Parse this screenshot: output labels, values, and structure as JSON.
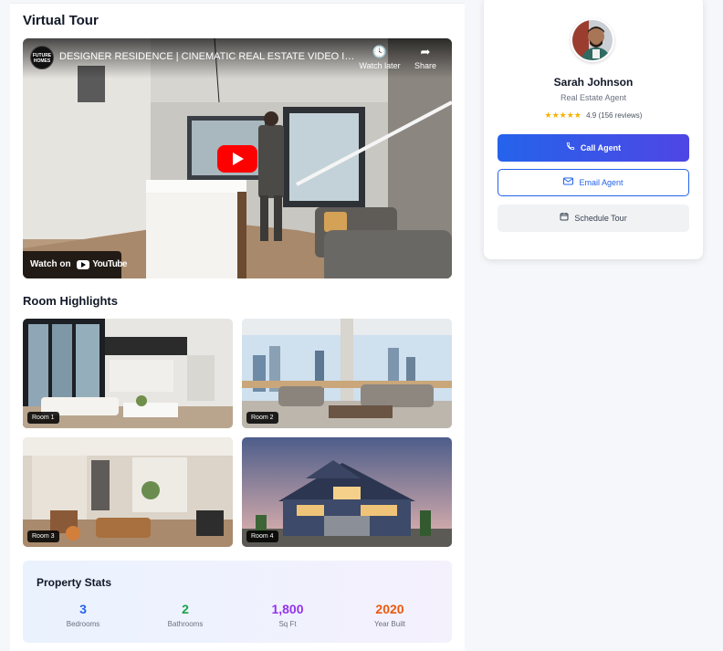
{
  "virtual_tour": {
    "title": "Virtual Tour",
    "video": {
      "channel_logo_text": "FUTURE HOMES",
      "title": "DESIGNER RESIDENCE | CINEMATIC REAL ESTATE VIDEO IN 4K...",
      "watch_later_label": "Watch later",
      "share_label": "Share",
      "watch_on_label": "Watch on",
      "youtube_label": "YouTube"
    }
  },
  "room_highlights": {
    "title": "Room Highlights",
    "rooms": [
      {
        "label": "Room 1"
      },
      {
        "label": "Room 2"
      },
      {
        "label": "Room 3"
      },
      {
        "label": "Room 4"
      }
    ]
  },
  "property_stats": {
    "title": "Property Stats",
    "items": [
      {
        "value": "3",
        "label": "Bedrooms",
        "color": "#2563eb"
      },
      {
        "value": "2",
        "label": "Bathrooms",
        "color": "#16a34a"
      },
      {
        "value": "1,800",
        "label": "Sq Ft",
        "color": "#9333ea"
      },
      {
        "value": "2020",
        "label": "Year Built",
        "color": "#ea580c"
      }
    ]
  },
  "agent": {
    "name": "Sarah Johnson",
    "role": "Real Estate Agent",
    "stars": "★★★★★",
    "rating_text": "4.9 (156 reviews)",
    "call_label": "Call Agent",
    "email_label": "Email Agent",
    "tour_label": "Schedule Tour"
  },
  "colors": {
    "accent": "#2563eb",
    "accent_secondary": "#4f46e5",
    "star": "#f5b301",
    "youtube_red": "#ff0000"
  },
  "icons": {
    "call": "phone-icon",
    "email": "mail-icon",
    "tour": "calendar-icon",
    "watch_later": "clock-icon",
    "share": "share-arrow-icon",
    "play": "play-icon"
  }
}
